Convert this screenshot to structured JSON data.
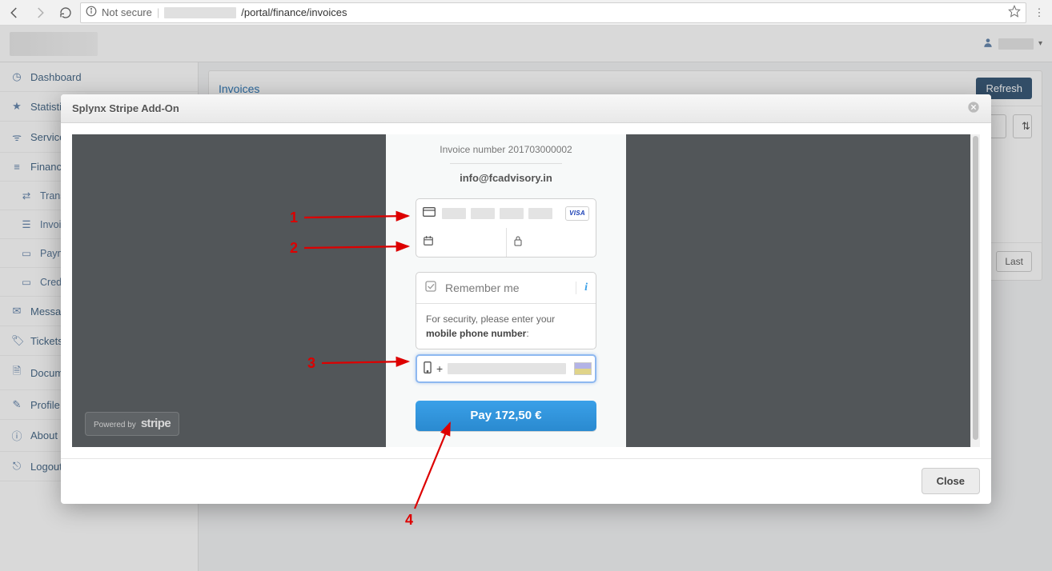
{
  "browser": {
    "not_secure_label": "Not secure",
    "url_host_hidden": true,
    "url_path": "/portal/finance/invoices"
  },
  "user_menu": {},
  "sidebar": {
    "items": [
      {
        "icon": "tachometer",
        "label": "Dashboard"
      },
      {
        "icon": "star",
        "label": "Statistics"
      },
      {
        "icon": "wifi",
        "label": "Services"
      },
      {
        "icon": "bars",
        "label": "Finance",
        "style": "section"
      },
      {
        "icon": "exchange",
        "label": "Transactions",
        "sub": true
      },
      {
        "icon": "list",
        "label": "Invoices",
        "sub": true
      },
      {
        "icon": "card",
        "label": "Payments",
        "sub": true
      },
      {
        "icon": "card",
        "label": "Credit cards",
        "sub": true
      },
      {
        "icon": "envelope",
        "label": "Messages"
      },
      {
        "icon": "tag",
        "label": "Tickets"
      },
      {
        "icon": "file",
        "label": "Documents"
      },
      {
        "icon": "pencil",
        "label": "Profile"
      },
      {
        "icon": "info",
        "label": "About"
      },
      {
        "icon": "signout",
        "label": "Logout"
      }
    ]
  },
  "page": {
    "title": "Invoices",
    "refresh_label": "Refresh",
    "pager": {
      "last": "Last"
    }
  },
  "modal": {
    "title": "Splynx Stripe Add-On",
    "close_label": "Close"
  },
  "stripe": {
    "invoice_line": "Invoice number 201703000002",
    "email": "info@fcadvisory.in",
    "remember_label": "Remember me",
    "security_line_1": "For security, please enter your",
    "security_line_2": "mobile phone number",
    "phone_prefix": "+",
    "pay_label": "Pay 172,50 €",
    "powered_by": "Powered by",
    "powered_brand": "stripe",
    "visa_label": "VISA"
  },
  "annotations": {
    "n1": "1",
    "n2": "2",
    "n3": "3",
    "n4": "4"
  }
}
